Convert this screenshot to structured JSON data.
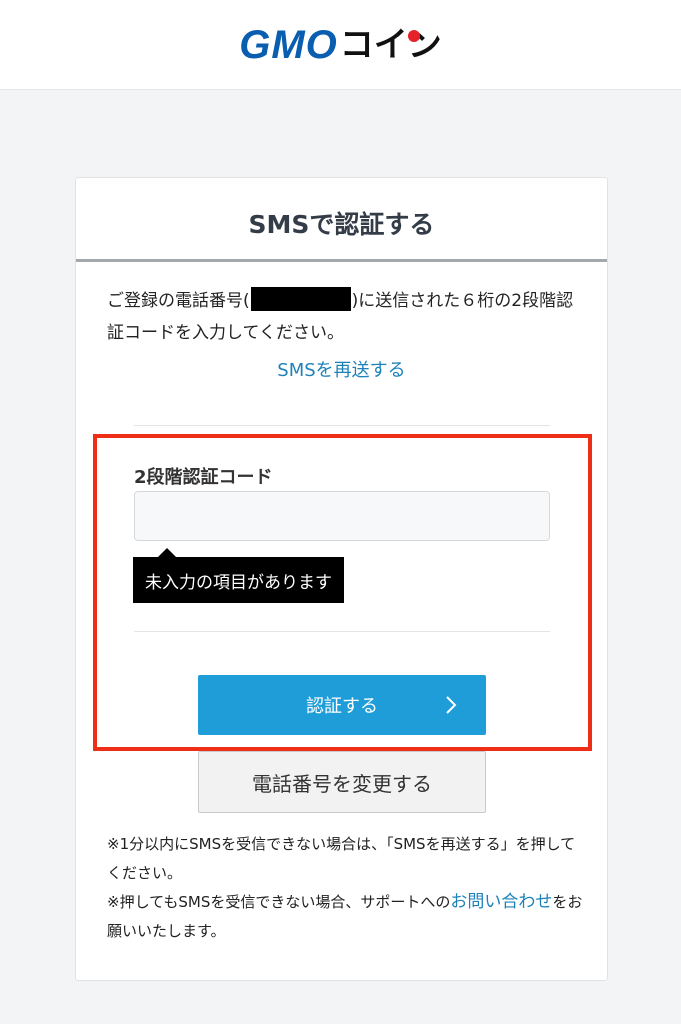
{
  "header": {
    "logo_primary": "GMO",
    "logo_secondary": "コイン"
  },
  "page": {
    "title": "SMSで認証する",
    "description_before": "ご登録の電話番号(",
    "description_after": ")に送信された６桁の2段階認証コードを入力してください。",
    "resend_link": "SMSを再送する"
  },
  "form": {
    "code_label": "2段階認証コード",
    "code_value": "",
    "code_placeholder": "",
    "error_tooltip": "未入力の項目があります",
    "submit_label": "認証する",
    "submit_icon": "chevron-right-icon",
    "change_phone_label": "電話番号を変更する"
  },
  "notes": {
    "line1": "※1分以内にSMSを受信できない場合は、「SMSを再送する」を押してください。",
    "line2_before": "※押してもSMSを受信できない場合、サポートへの",
    "line2_link": "お問い合わせ",
    "line2_after": "をお願いいたします。"
  },
  "colors": {
    "brand_blue": "#0a5eb0",
    "accent": "#1e9dd8",
    "link": "#1e82b9",
    "highlight": "#ee2e16"
  }
}
